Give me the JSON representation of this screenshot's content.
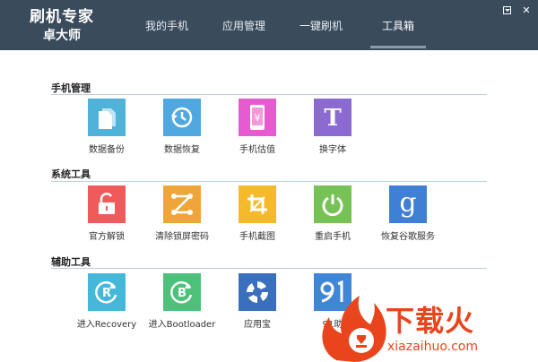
{
  "app": {
    "title_line1": "刷机专家",
    "title_line2": "卓大师"
  },
  "nav": {
    "tabs": [
      {
        "label": "我的手机",
        "active": false
      },
      {
        "label": "应用管理",
        "active": false
      },
      {
        "label": "一键刷机",
        "active": false
      },
      {
        "label": "工具箱",
        "active": true
      }
    ]
  },
  "window": {
    "menu_icon": "menu-icon",
    "close_label": "✕"
  },
  "sections": [
    {
      "title": "手机管理",
      "items": [
        {
          "label": "数据备份",
          "icon": "document-copy-icon",
          "color": "#4fb3d9"
        },
        {
          "label": "数据恢复",
          "icon": "clock-restore-icon",
          "color": "#4fa8e0"
        },
        {
          "label": "手机估值",
          "icon": "phone-yen-icon",
          "color": "#e75bd0"
        },
        {
          "label": "换字体",
          "icon": "font-t-icon",
          "color": "#8b6bd1"
        }
      ]
    },
    {
      "title": "系统工具",
      "items": [
        {
          "label": "官方解锁",
          "icon": "unlock-icon",
          "color": "#ef5b5b"
        },
        {
          "label": "清除锁屏密码",
          "icon": "pattern-lock-icon",
          "color": "#f0a53a"
        },
        {
          "label": "手机截图",
          "icon": "crop-icon",
          "color": "#f5ba2a"
        },
        {
          "label": "重启手机",
          "icon": "power-icon",
          "color": "#76c255"
        },
        {
          "label": "恢复谷歌服务",
          "icon": "google-g-icon",
          "color": "#3f7fd6"
        }
      ]
    },
    {
      "title": "辅助工具",
      "items": [
        {
          "label": "进入Recovery",
          "icon": "recovery-r-icon",
          "color": "#45b8da"
        },
        {
          "label": "进入Bootloader",
          "icon": "bootloader-b-icon",
          "color": "#4dc07a"
        },
        {
          "label": "应用宝",
          "icon": "yingyongbao-icon",
          "color": "#3a6fbd"
        },
        {
          "label": "91助",
          "icon": "91-icon",
          "color": "#3f86d6"
        }
      ]
    }
  ],
  "watermark": {
    "text": "下载火",
    "subtext": "xiazaihuo.com",
    "icon": "flame-logo-icon",
    "color": "#e8451d"
  }
}
